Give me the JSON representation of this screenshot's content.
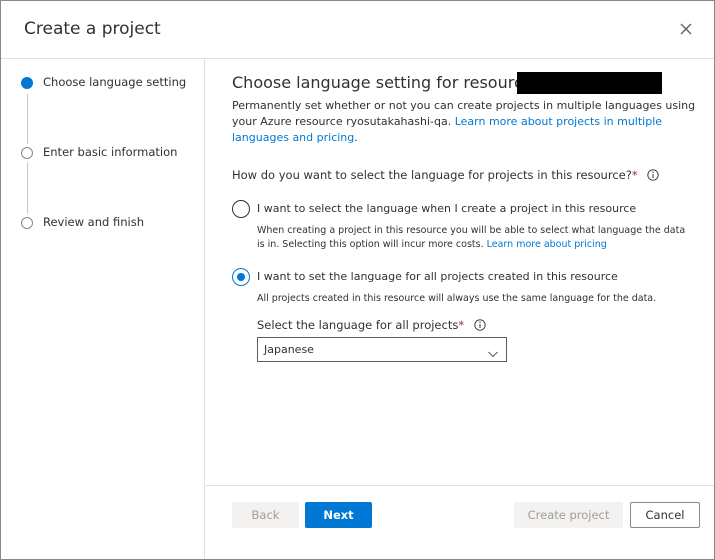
{
  "dialog": {
    "title": "Create a project"
  },
  "steps": [
    {
      "label": "Choose language setting",
      "state": "active"
    },
    {
      "label": "Enter basic information",
      "state": "inactive"
    },
    {
      "label": "Review and finish",
      "state": "inactive"
    }
  ],
  "content": {
    "title": "Choose language setting for resource",
    "description_prefix": "Permanently set whether or not you can create projects in multiple languages using your Azure resource ryosutakahashi-qa.",
    "description_link": "Learn more about projects in multiple languages and pricing",
    "description_suffix": ".",
    "question": "How do you want to select the language for projects in this resource?",
    "required_mark": "*",
    "options": [
      {
        "label": "I want to select the language when I create a project in this resource",
        "description": "When creating a project in this resource you will be able to select what language the data is in. Selecting this option will incur more costs.",
        "description_link": "Learn more about pricing",
        "checked": false
      },
      {
        "label": "I want to set the language for all projects created in this resource",
        "description": "All projects created in this resource will always use the same language for the data.",
        "checked": true
      }
    ],
    "language_select": {
      "label": "Select the language for all projects",
      "value": "Japanese"
    }
  },
  "footer": {
    "back_label": "Back",
    "next_label": "Next",
    "create_label": "Create project",
    "cancel_label": "Cancel"
  },
  "colors": {
    "accent": "#0078d4",
    "required": "#a4262c",
    "disabled_text": "#a19f9d"
  }
}
